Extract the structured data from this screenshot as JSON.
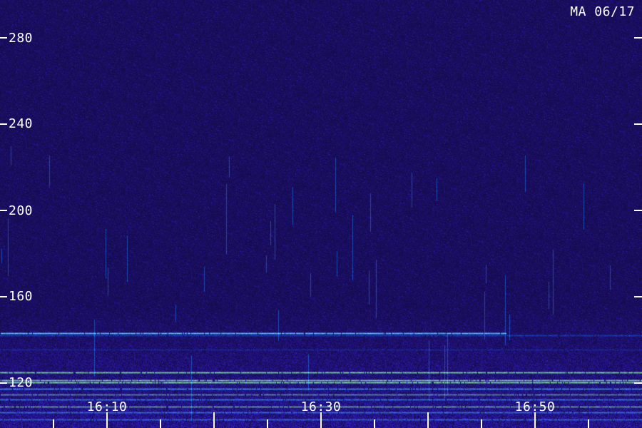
{
  "station": {
    "label": "MA 06/17"
  },
  "frequency_axis": {
    "labels": [
      "280",
      "240",
      "200",
      "160",
      "120"
    ],
    "tick_color": "#ffffff"
  },
  "time_axis": {
    "labels": [
      "16:10",
      "16:30",
      "16:50"
    ]
  },
  "colors": {
    "background": "#1a0f6e",
    "noise_blue": "#2b1fb0",
    "signal_cyan": "#3fd7ff",
    "signal_green": "#7dff3a",
    "label_white": "#ffffff"
  }
}
